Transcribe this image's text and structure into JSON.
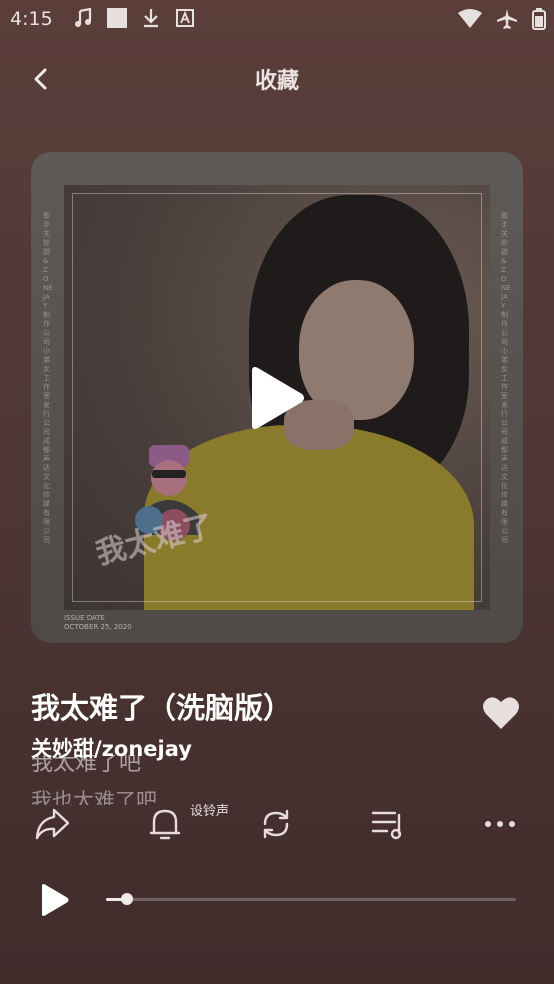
{
  "status_bar": {
    "time": "4:15",
    "left_icons": [
      "music-note-icon",
      "square-icon",
      "download-icon",
      "font-icon"
    ],
    "right_icons": [
      "wifi-icon",
      "airplane-icon",
      "battery-icon"
    ]
  },
  "nav": {
    "title": "收藏"
  },
  "cover": {
    "sticker_text": "我太难了",
    "issue_label": "ISSUE DATE",
    "issue_date": "OCTOBER 25, 2020",
    "side_text_left": "歌手 关妙甜&ZONEJAY 制作公司 小弟女工作室 发行公司 成都声达文化传媒有限公司",
    "side_text_right": "歌手 关妙甜&ZONEJAY 制作公司 小弟女工作室 发行公司 成都声达文化传媒有限公司"
  },
  "song": {
    "title": "我太难了（洗脑版）",
    "artist": "关妙甜/zonejay",
    "lyric_current": "我太难了吧",
    "lyric_next": "我也太难了吧"
  },
  "actions": {
    "ringtone_label": "设铃声",
    "items": [
      "share-icon",
      "bell-icon",
      "repeat-icon",
      "playlist-icon",
      "more-icon"
    ]
  },
  "player": {
    "progress": 0.05
  },
  "colors": {
    "accent": "#f2eaea",
    "background": "#4f3735"
  }
}
